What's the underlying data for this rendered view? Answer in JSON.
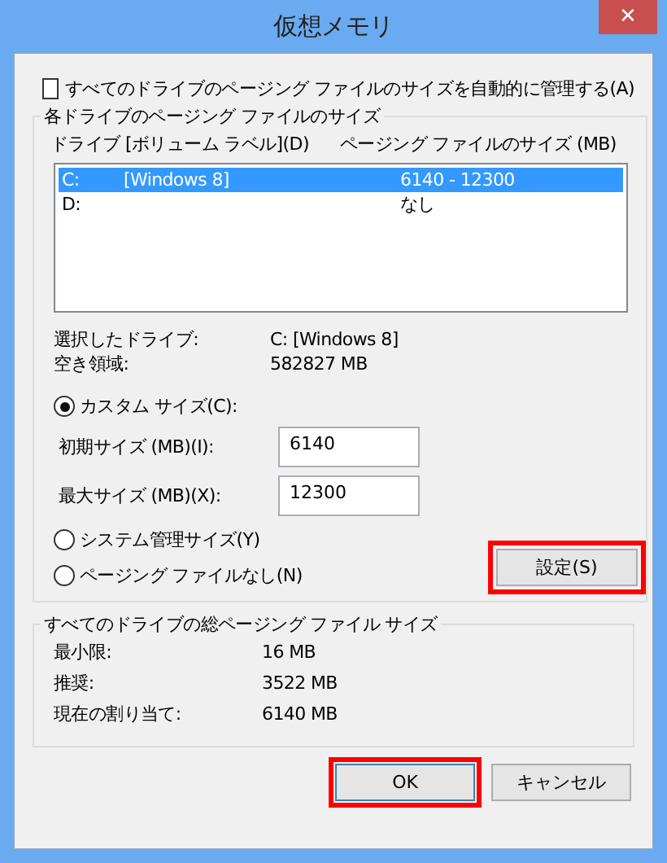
{
  "window": {
    "title": "仮想メモリ",
    "close": "✕"
  },
  "auto_manage": {
    "label": "すべてのドライブのページング ファイルのサイズを自動的に管理する(A)",
    "checked": false
  },
  "per_drive": {
    "title": "各ドライブのページング ファイルのサイズ",
    "columns": [
      "ドライブ  [ボリューム ラベル](D)",
      "ページング ファイルのサイズ (MB)"
    ],
    "rows": [
      {
        "drive": "C:",
        "label": "[Windows 8]",
        "size": "6140 - 12300",
        "selected": true
      },
      {
        "drive": "D:",
        "label": "",
        "size": "なし",
        "selected": false
      }
    ],
    "info": [
      {
        "label": "選択したドライブ:",
        "value": "C:  [Windows 8]"
      },
      {
        "label": "空き領域:",
        "value": "582827 MB"
      }
    ],
    "options": [
      {
        "label": "カスタム サイズ(C):",
        "selected": true,
        "fields": [
          {
            "label": "初期サイズ (MB)(I):",
            "value": "6140"
          },
          {
            "label": "最大サイズ (MB)(X):",
            "value": "12300"
          }
        ]
      },
      {
        "label": "システム管理サイズ(Y)",
        "selected": false
      },
      {
        "label": "ページング ファイルなし(N)",
        "selected": false
      }
    ],
    "set_button": {
      "label": "設定(S)",
      "highlighted": true
    }
  },
  "totals": {
    "title": "すべてのドライブの総ページング ファイル サイズ",
    "rows": [
      {
        "label": "最小限:",
        "value": "16 MB"
      },
      {
        "label": "推奨:",
        "value": "3522 MB"
      },
      {
        "label": "現在の割り当て:",
        "value": "6140 MB"
      }
    ]
  },
  "buttons": [
    {
      "label": "OK",
      "highlighted": true,
      "default": true
    },
    {
      "label": "キャンセル",
      "highlighted": false,
      "default": false
    }
  ]
}
